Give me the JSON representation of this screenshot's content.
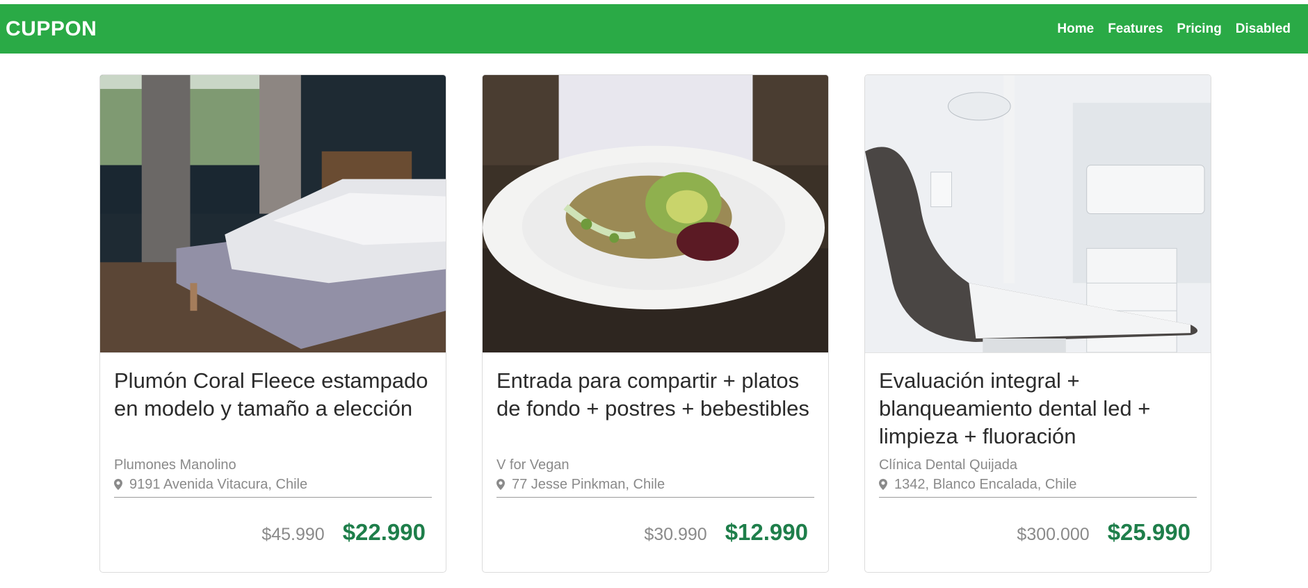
{
  "navbar": {
    "brand": "CUPPON",
    "links": [
      {
        "label": "Home"
      },
      {
        "label": "Features"
      },
      {
        "label": "Pricing"
      },
      {
        "label": "Disabled"
      }
    ],
    "color": "#2aaa46"
  },
  "cards": [
    {
      "title": "Plumón Coral Fleece estampado en modelo y tamaño a elección",
      "merchant": "Plumones Manolino",
      "address": "9191 Avenida Vitacura, Chile",
      "old_price": "$45.990",
      "new_price": "$22.990",
      "image": "bedroom-bed-photo"
    },
    {
      "title": "Entrada para compartir + platos de fondo + postres + bebestibles",
      "merchant": "V for Vegan",
      "address": "77 Jesse Pinkman, Chile",
      "old_price": "$30.990",
      "new_price": "$12.990",
      "image": "vegan-salad-plate-photo"
    },
    {
      "title": "Evaluación integral + blanqueamiento dental led + limpieza + fluoración",
      "merchant": "Clínica Dental Quijada",
      "address": "1342, Blanco Encalada, Chile",
      "old_price": "$300.000",
      "new_price": "$25.990",
      "image": "dental-chair-photo"
    }
  ],
  "colors": {
    "price_new": "#1e7e4a",
    "price_old": "#8a8a8a"
  }
}
